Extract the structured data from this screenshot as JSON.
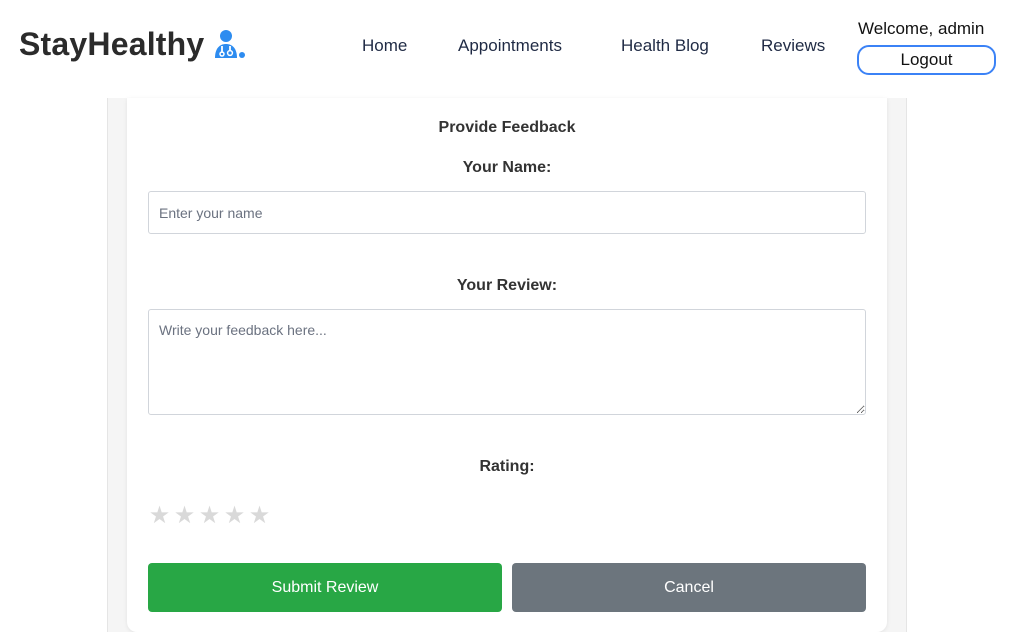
{
  "navbar": {
    "brand": "StayHealthy",
    "brand_icon": "doctor-icon",
    "links": [
      {
        "label": "Home"
      },
      {
        "label": "Appointments"
      },
      {
        "label": "Health Blog"
      },
      {
        "label": "Reviews"
      }
    ],
    "welcome": "Welcome, admin",
    "logout_label": "Logout"
  },
  "form": {
    "title": "Provide Feedback",
    "name_label": "Your Name:",
    "name_placeholder": "Enter your name",
    "name_value": "",
    "review_label": "Your Review:",
    "review_placeholder": "Write your feedback here...",
    "review_value": "",
    "rating_label": "Rating:",
    "rating": {
      "value": 0,
      "max": 5,
      "star_glyph": "★",
      "empty_color": "#d9d9d9"
    },
    "submit_label": "Submit Review",
    "cancel_label": "Cancel"
  },
  "colors": {
    "accent": "#3b82f6",
    "submit": "#28a745",
    "cancel": "#6c757d"
  }
}
